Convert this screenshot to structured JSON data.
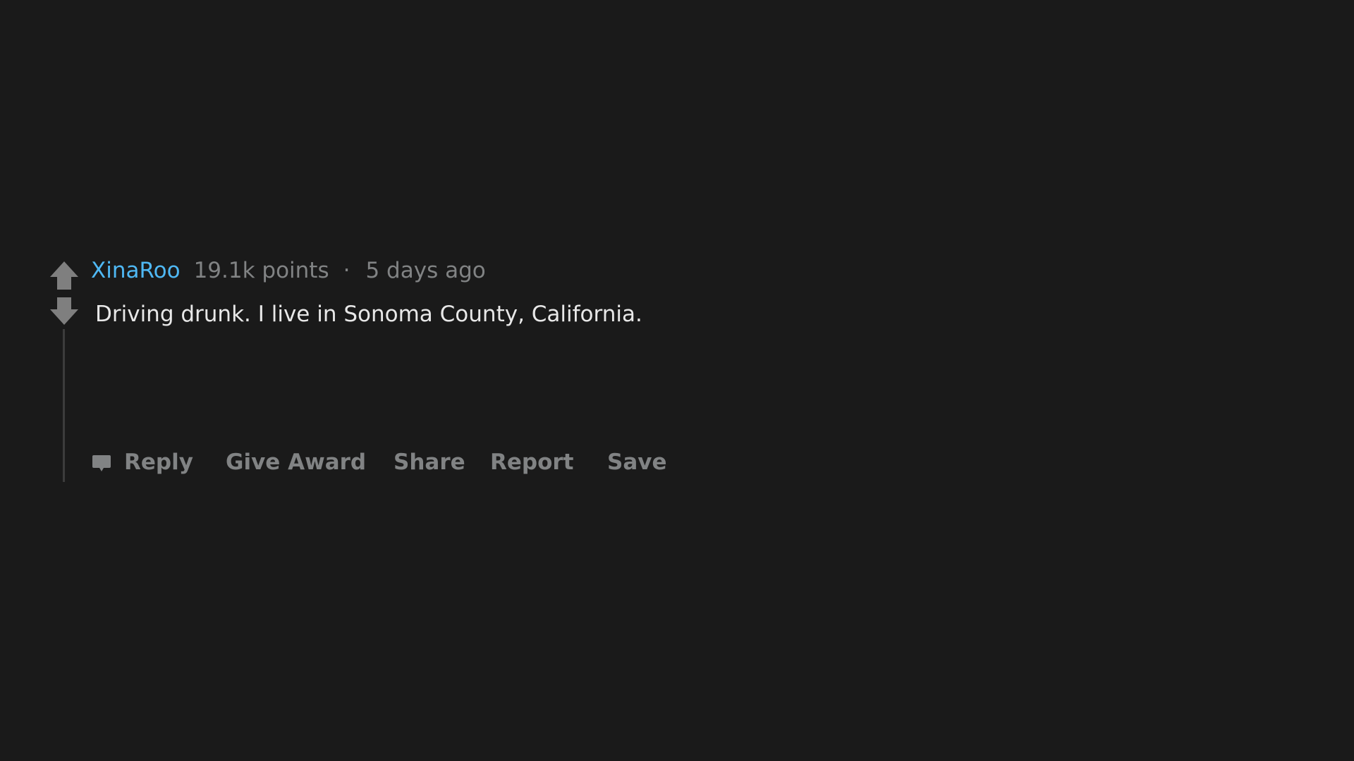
{
  "comment": {
    "author": "XinaRoo",
    "score": "19.1k points",
    "separator": "·",
    "timestamp": "5 days ago",
    "body": "Driving drunk. I live in Sonoma County, California."
  },
  "actions": {
    "reply": "Reply",
    "give_award": "Give Award",
    "share": "Share",
    "report": "Report",
    "save": "Save"
  },
  "icons": {
    "upvote": "arrow-up-icon",
    "downvote": "arrow-down-icon",
    "reply": "comment-bubble-icon"
  },
  "colors": {
    "background": "#1a1a1a",
    "author": "#4fb8f4",
    "muted": "#818384",
    "body_text": "#e8e8e8",
    "thread_line": "#3c3c3c",
    "vote_arrow": "#7f7f7f"
  }
}
